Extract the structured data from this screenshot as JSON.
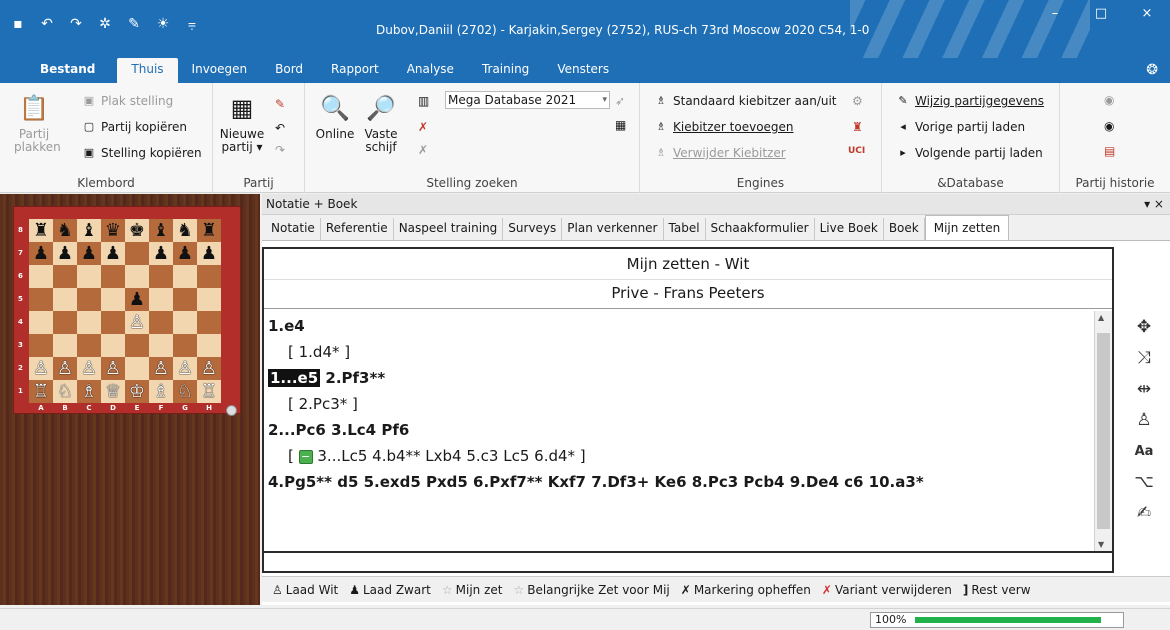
{
  "window": {
    "title": "Dubov,Daniil (2702) - Karjakin,Sergey (2752), RUS-ch 73rd Moscow 2020  C54, 1-0",
    "minimize": "–",
    "maximize": "□",
    "close": "×"
  },
  "ribbon_tabs": [
    "Bestand",
    "Thuis",
    "Invoegen",
    "Bord",
    "Rapport",
    "Analyse",
    "Training",
    "Vensters"
  ],
  "ribbon": {
    "klembord": {
      "label": "Klembord",
      "paste_line1": "Partij",
      "paste_line2": "plakken",
      "plak_stelling": "Plak stelling",
      "partij_kopieren": "Partij kopiëren",
      "stelling_kopieren": "Stelling kopiëren"
    },
    "partij": {
      "label": "Partij",
      "nieuwe_line1": "Nieuwe",
      "nieuwe_line2": "partij ▾"
    },
    "stelling_zoeken": {
      "label": "Stelling zoeken",
      "online": "Online",
      "vaste_line1": "Vaste",
      "vaste_line2": "schijf",
      "database": "Mega Database 2021"
    },
    "engines": {
      "label": "Engines",
      "standaard": "Standaard kiebitzer aan/uit",
      "toevoegen": "Kiebitzer toevoegen",
      "verwijder": "Verwijder Kiebitzer"
    },
    "database": {
      "label": "&Database",
      "wijzig": "Wijzig partijgegevens",
      "vorige": "Vorige partij laden",
      "volgende": "Volgende partij laden"
    },
    "historie": {
      "label": "Partij historie"
    }
  },
  "board": {
    "ranks": [
      "8",
      "7",
      "6",
      "5",
      "4",
      "3",
      "2",
      "1"
    ],
    "files": [
      "A",
      "B",
      "C",
      "D",
      "E",
      "F",
      "G",
      "H"
    ],
    "position": [
      [
        "♜",
        "♞",
        "♝",
        "♛",
        "♚",
        "♝",
        "♞",
        "♜"
      ],
      [
        "♟",
        "♟",
        "♟",
        "♟",
        "",
        "♟",
        "♟",
        "♟"
      ],
      [
        "",
        "",
        "",
        "",
        "",
        "",
        "",
        ""
      ],
      [
        "",
        "",
        "",
        "",
        "♟",
        "",
        "",
        ""
      ],
      [
        "",
        "",
        "",
        "",
        "♙",
        "",
        "",
        ""
      ],
      [
        "",
        "",
        "",
        "",
        "",
        "",
        "",
        ""
      ],
      [
        "♙",
        "♙",
        "♙",
        "♙",
        "",
        "♙",
        "♙",
        "♙"
      ],
      [
        "♖",
        "♘",
        "♗",
        "♕",
        "♔",
        "♗",
        "♘",
        "♖"
      ]
    ]
  },
  "pane": {
    "title": "Notatie + Boek",
    "controls": "▾ ×",
    "tabs": [
      "Notatie",
      "Referentie",
      "Naspeel training",
      "Surveys",
      "Plan verkenner",
      "Tabel",
      "Schaakformulier",
      "Live Boek",
      "Boek",
      "Mijn zetten"
    ],
    "heading": "Mijn zetten - Wit",
    "subheading": "Prive - Frans Peeters",
    "moves": {
      "l1": "1.e4",
      "l2": "[ 1.d4* ]",
      "l3_hl": "1...e5",
      "l3_rest": " 2.Pf3**",
      "l4": "[ 2.Pc3* ]",
      "l5": "2...Pc6  3.Lc4  Pf6",
      "l6_open": "[ ",
      "l6_rest": " 3...Lc5  4.b4**  Lxb4  5.c3  Lc5  6.d4* ]",
      "l7": "4.Pg5**  d5  5.exd5  Pxd5  6.Pxf7**  Kxf7  7.Df3+  Ke6  8.Pc3  Pcb4  9.De4  c6  10.a3*"
    },
    "bottom_actions": [
      "Laad Wit",
      "Laad Zwart",
      "Mijn zet",
      "Belangrijke Zet voor Mij",
      "Markering opheffen",
      "Variant verwijderen",
      "Rest verw"
    ]
  },
  "status": {
    "zoom": "100%",
    "zoom_fraction": 1.0
  }
}
